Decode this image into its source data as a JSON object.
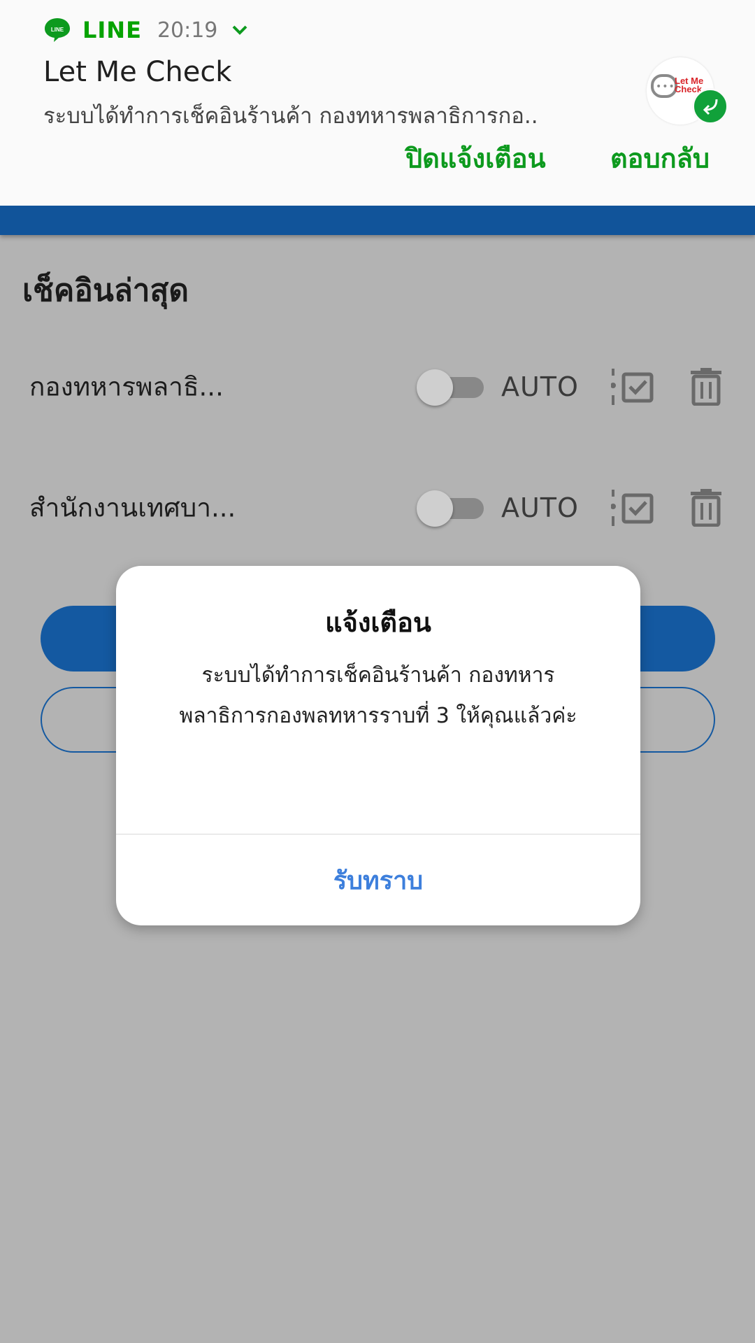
{
  "notification": {
    "app_name": "LINE",
    "time": "20:19",
    "title": "Let Me Check",
    "body": "ระบบได้ทำการเช็คอินร้านค้า กองทหารพลาธิการกอ..",
    "avatar_text_line1": "Let Me",
    "avatar_text_line2": "Check",
    "actions": {
      "dismiss": "ปิดแจ้งเตือน",
      "reply": "ตอบกลับ"
    },
    "colors": {
      "accent": "#0d9a1e",
      "badge": "#11a13a"
    }
  },
  "main": {
    "section_title": "เช็คอินล่าสุด",
    "rows": [
      {
        "name": "กองทหารพลาธิ...",
        "toggle_label": "AUTO",
        "toggle_on": false
      },
      {
        "name": "สำนักงานเทศบา...",
        "toggle_label": "AUTO",
        "toggle_on": false
      }
    ],
    "colors": {
      "app_bar": "#11549a",
      "primary_button": "#1459a1"
    }
  },
  "dialog": {
    "title": "แจ้งเตือน",
    "message": "ระบบได้ทำการเช็คอินร้านค้า กองทหารพลาธิการกองพลทหารราบที่ 3 ให้คุณแล้วค่ะ",
    "button": "รับทราบ",
    "colors": {
      "button_text": "#3d7fdc"
    }
  },
  "icons": {
    "line_logo": "line-logo-icon",
    "expand": "chevron-down-icon",
    "reply_badge": "reply-arrow-icon",
    "checklist": "checklist-icon",
    "trash": "trash-icon"
  }
}
